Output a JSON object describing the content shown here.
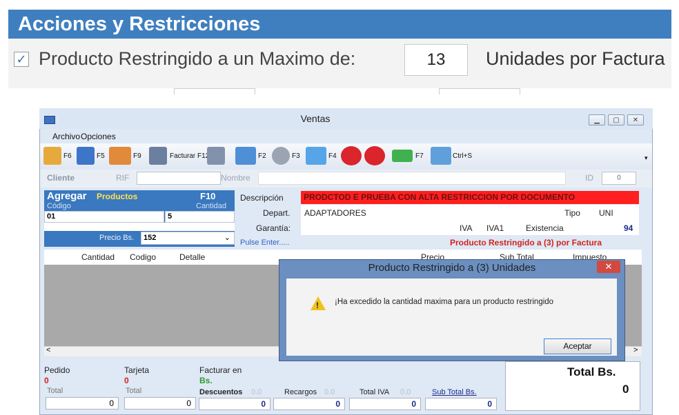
{
  "zoom": {
    "header": "Acciones y Restricciones",
    "checkbox_checked": true,
    "restrict_label": "Producto Restringido a un Maximo de:",
    "max_units": "13",
    "units_label": "Unidades por Factura"
  },
  "window": {
    "title": "Ventas",
    "menu": [
      "Archivo",
      "Opciones"
    ],
    "toolbar": {
      "f6": "F6",
      "f5": "F5",
      "f9": "F9",
      "facturar": "Facturar F12",
      "f2": "F2",
      "f3": "F3",
      "f4": "F4",
      "f7": "F7",
      "ctrls": "Ctrl+S"
    },
    "client": {
      "cliente_label": "Cliente",
      "rif_label": "RIF",
      "nombre_label": "Nombre",
      "id_label": "ID",
      "id_value": "0"
    },
    "agregar": {
      "title": "Agregar",
      "productos": "Productos",
      "f10": "F10",
      "codigo_label": "Código",
      "cantidad_label": "Cantidad",
      "codigo_value": "01",
      "cantidad_value": "5",
      "precio_label": "Precio Bs.",
      "precio_value": "152"
    },
    "product": {
      "descripcion_label": "Descripción",
      "descripcion_value": "PRODCTOD E PRUEBA CON ALTA RESTRICCION POR DOCUMENTO",
      "depart_label": "Depart.",
      "depart_value": "ADAPTADORES",
      "tipo_label": "Tipo",
      "tipo_value": "UNI",
      "garantia_label": "Garantía:",
      "iva_label": "IVA",
      "iva_value": "IVA1",
      "existencia_label": "Existencia",
      "existencia_value": "94",
      "pulse": "Pulse Enter.....",
      "restriccion_msg": "Producto Restringido a (3) por Factura"
    },
    "grid": {
      "columns": [
        "Cantidad",
        "Codigo",
        "Detalle",
        "Precio",
        "Sub Total",
        "Impuesto"
      ]
    },
    "footer": {
      "pedido_label": "Pedido",
      "pedido_value": "0",
      "tarjeta_label": "Tarjeta",
      "tarjeta_value": "0",
      "facturar_label": "Facturar en",
      "facturar_value": "Bs.",
      "total1_label": "Total",
      "total1_value": "0",
      "total2_label": "Total",
      "total2_value": "0",
      "descuentos_label": "Descuentos",
      "descuentos_small": "0.0",
      "descuentos_value": "0",
      "recargos_label": "Recargos",
      "recargos_small": "0.0",
      "recargos_value": "0",
      "totaliva_label": "Total IVA",
      "totaliva_small": "0.0",
      "totaliva_value": "0",
      "subtotal_label": "Sub Total Bs.",
      "subtotal_value": "0",
      "totalbs_label": "Total Bs.",
      "totalbs_value": "0"
    },
    "dialog": {
      "title": "Producto Restringido a (3) Unidades",
      "message": "¡Ha excedido la cantidad maxima para un producto restringido",
      "ok_button": "Aceptar"
    }
  }
}
